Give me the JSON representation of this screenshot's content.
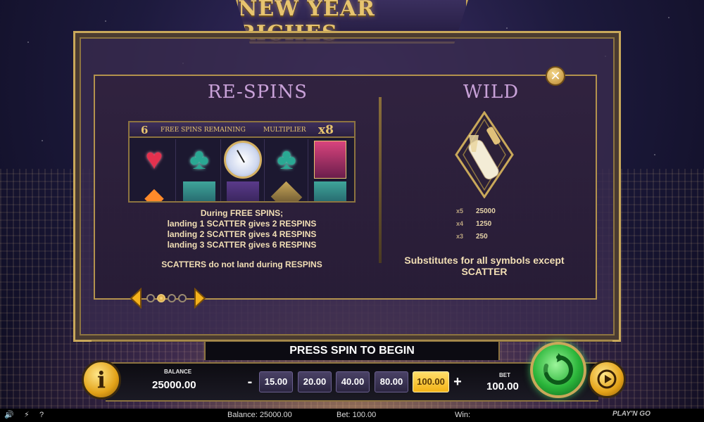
{
  "game": {
    "title": "NEW YEAR RICHES"
  },
  "respins": {
    "title": "RE-SPINS",
    "preview": {
      "free_spins_count": "6",
      "free_spins_label": "FREE SPINS REMAINING",
      "multiplier_label": "MULTIPLIER",
      "multiplier_value": "x8"
    },
    "lines": [
      "During FREE SPINS;",
      "landing 1 SCATTER gives 2 RESPINS",
      "landing 2 SCATTER gives 4 RESPINS",
      "landing 3 SCATTER gives 6 RESPINS"
    ],
    "note": "SCATTERS do not land during RESPINS"
  },
  "wild": {
    "title": "WILD",
    "payouts": [
      {
        "multiplier": "x5",
        "value": "25000"
      },
      {
        "multiplier": "x4",
        "value": "1250"
      },
      {
        "multiplier": "x3",
        "value": "250"
      }
    ],
    "description_line1": "Substitutes for all symbols except",
    "description_line2": "SCATTER"
  },
  "pager": {
    "page_count": 4,
    "active_index": 1
  },
  "controls": {
    "press_spin": "PRESS SPIN TO BEGIN",
    "balance_label": "BALANCE",
    "balance_value": "25000.00",
    "minus": "-",
    "plus": "+",
    "bet_options": [
      "15.00",
      "20.00",
      "40.00",
      "80.00",
      "100.00"
    ],
    "selected_bet": "100.00",
    "bet_label": "BET",
    "bet_value": "100.00",
    "info_glyph": "i"
  },
  "status_bar": {
    "balance": "Balance: 25000.00",
    "bet": "Bet: 100.00",
    "win": "Win:",
    "help": "?",
    "brand": "PLAY'N GO"
  },
  "colors": {
    "gold": "#c9a85a",
    "panel": "#30223e",
    "selected_bet": "#f3b316",
    "spin_green": "#2bb53a"
  },
  "icons": [
    "close-icon",
    "info-icon",
    "spin-icon",
    "autoplay-icon",
    "sound-icon",
    "turbo-icon",
    "arrow-left-icon",
    "arrow-right-icon"
  ]
}
